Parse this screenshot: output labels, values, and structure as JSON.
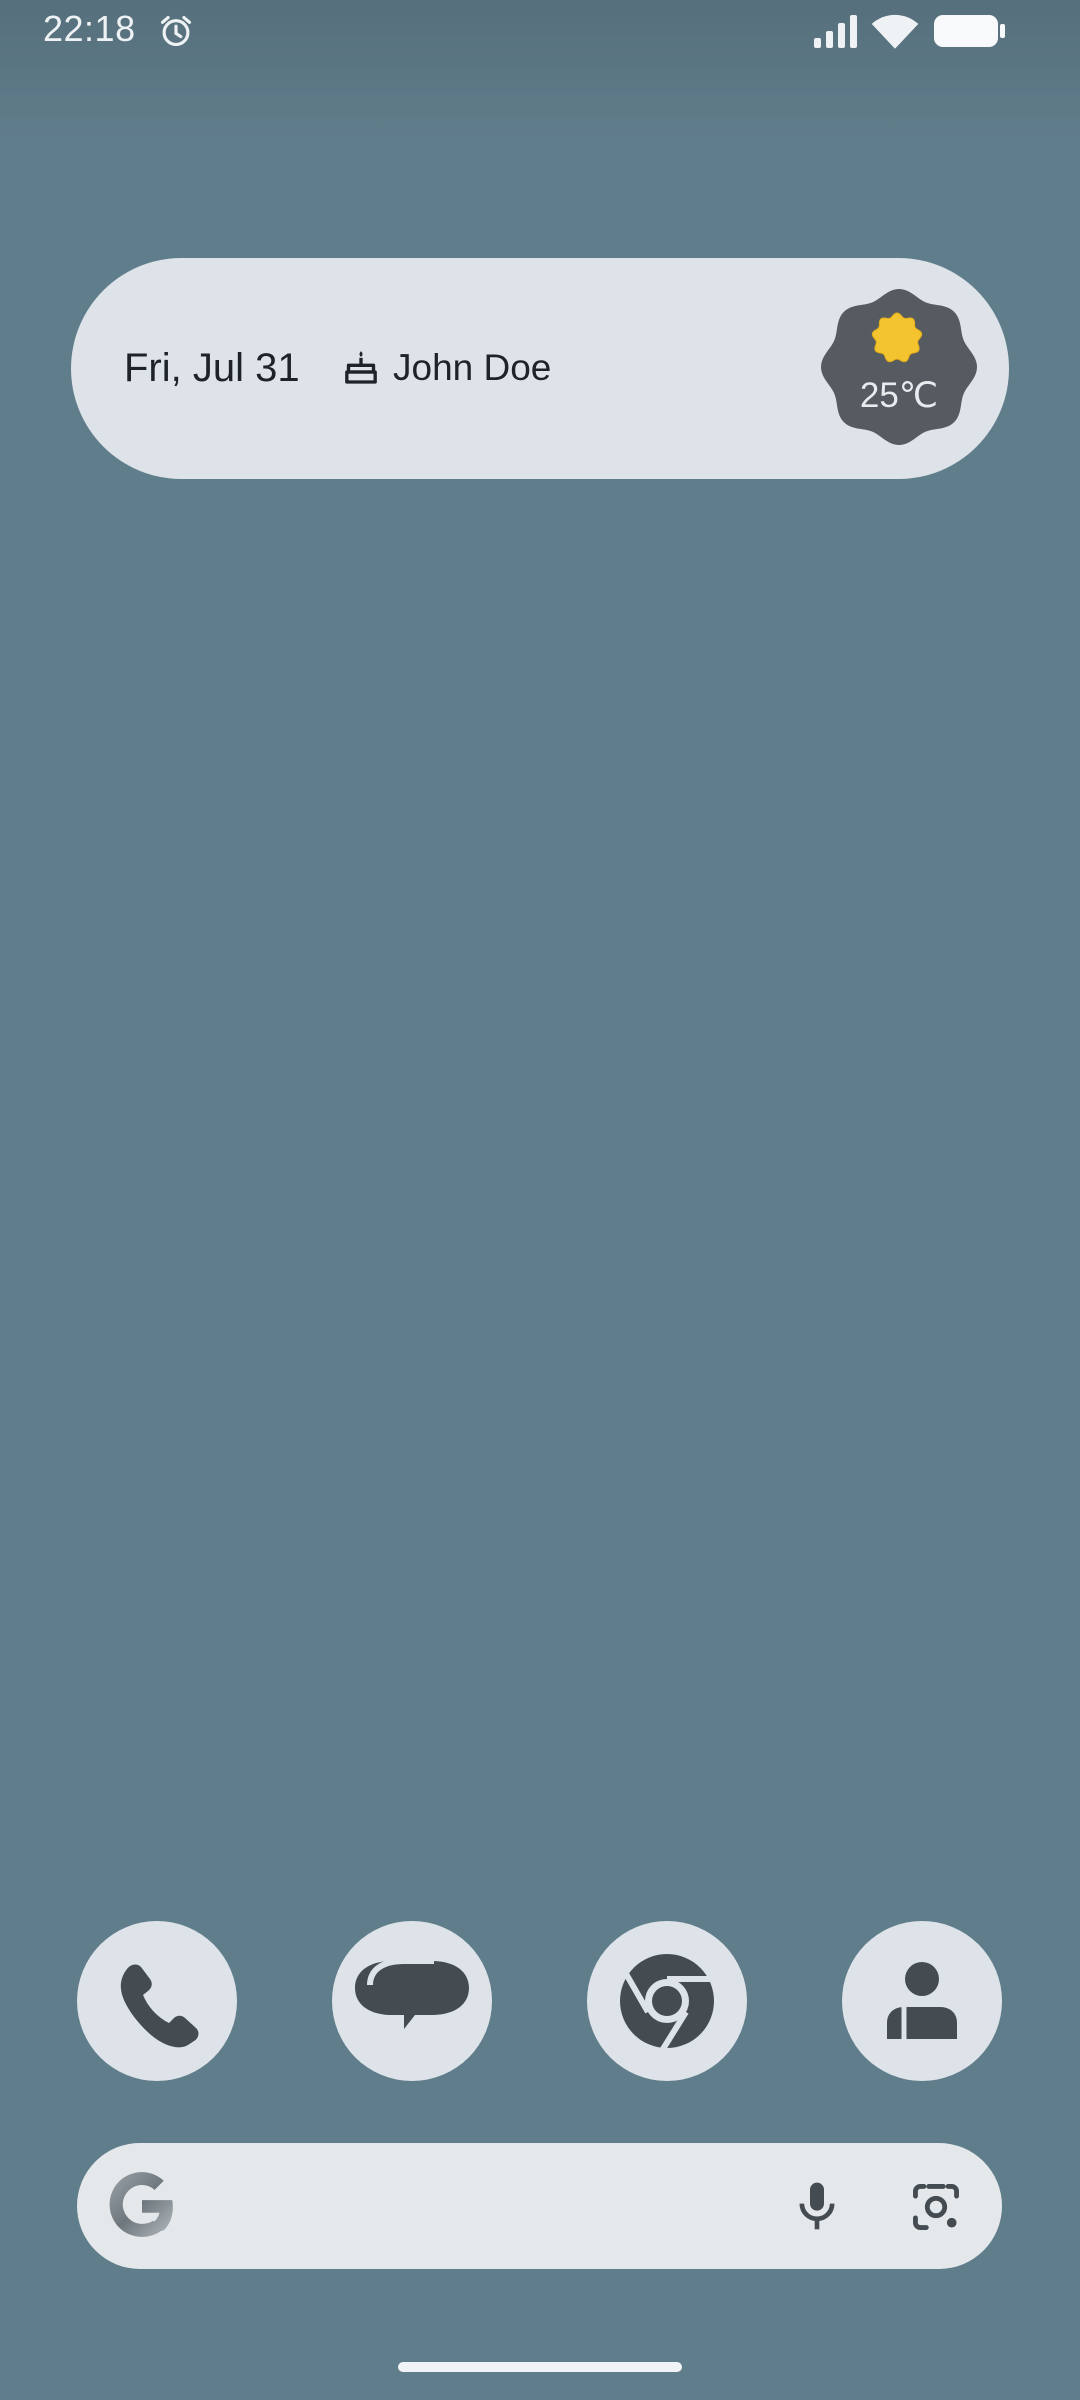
{
  "status_bar": {
    "time": "22:18",
    "icons": [
      "alarm-icon",
      "signal-icon",
      "wifi-icon",
      "battery-icon"
    ]
  },
  "glance": {
    "date": "Fri, Jul 31",
    "event_icon": "cake-icon",
    "event": "John Doe",
    "weather": {
      "icon": "sun-icon",
      "temperature": "25℃"
    }
  },
  "dock": {
    "apps": [
      {
        "name": "Phone",
        "icon": "phone-icon"
      },
      {
        "name": "Messages",
        "icon": "messages-icon"
      },
      {
        "name": "Chrome",
        "icon": "chrome-icon"
      },
      {
        "name": "Contacts",
        "icon": "contacts-icon"
      }
    ]
  },
  "search_bar": {
    "logo": "google-logo",
    "actions": [
      "mic-icon",
      "lens-icon"
    ]
  },
  "colors": {
    "wallpaper": "#607d8b",
    "surface": "#dde3e8",
    "icon_dark": "#444c52",
    "sun": "#f4c430"
  }
}
